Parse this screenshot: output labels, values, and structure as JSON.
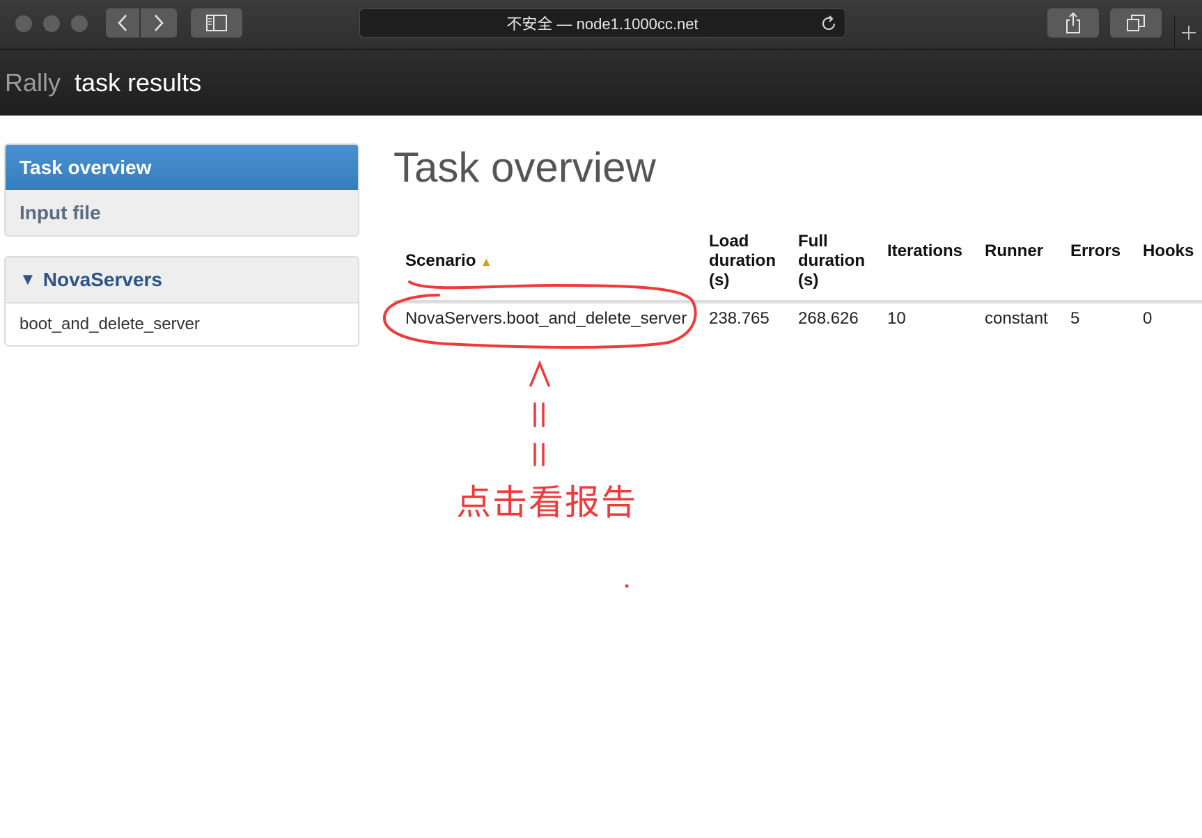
{
  "browser": {
    "url_text": "不安全 — node1.1000cc.net",
    "buttons": [
      "back",
      "forward",
      "sidebar",
      "share",
      "tabs",
      "new-tab"
    ]
  },
  "navbar": {
    "brand": "Rally",
    "title": "task results"
  },
  "sidebar": {
    "menu": [
      {
        "label": "Task overview",
        "active": true
      },
      {
        "label": "Input file",
        "active": false
      }
    ],
    "group": {
      "toggle": "▼",
      "label": "NovaServers",
      "items": [
        "boot_and_delete_server"
      ]
    }
  },
  "main": {
    "title": "Task overview",
    "table": {
      "headers": {
        "scenario": "Scenario",
        "sort_indicator": "▲",
        "load_duration": [
          "Load",
          "duration",
          "(s)"
        ],
        "full_duration": [
          "Full",
          "duration",
          "(s)"
        ],
        "iterations": "Iterations",
        "runner": "Runner",
        "errors": "Errors",
        "hooks": "Hooks"
      },
      "rows": [
        {
          "scenario": "NovaServers.boot_and_delete_server",
          "load_duration": "238.765",
          "full_duration": "268.626",
          "iterations": "10",
          "runner": "constant",
          "errors": "5",
          "hooks": "0"
        }
      ]
    }
  },
  "annotation": {
    "text": "点击看报告",
    "color": "#ef3a3a"
  },
  "colors": {
    "accent": "#357ebd",
    "sort_arrow": "#d4a017"
  }
}
